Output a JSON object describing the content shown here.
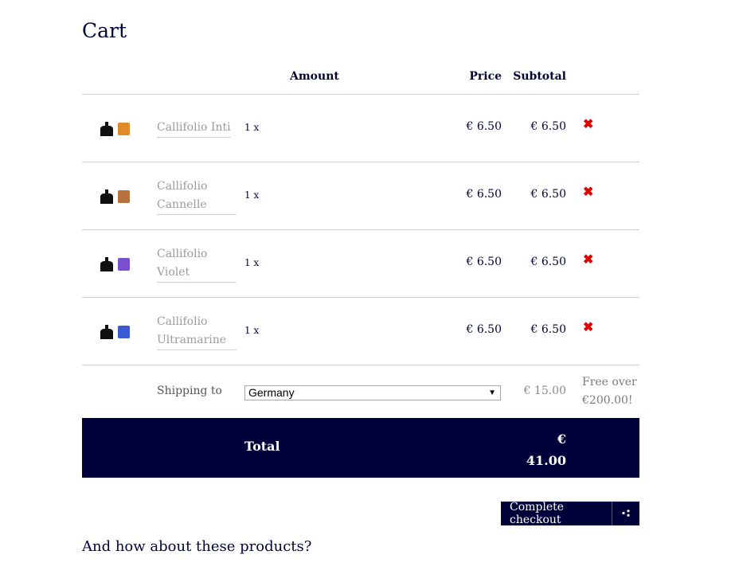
{
  "page": {
    "title": "Cart",
    "suggestions_title": "And how about these products?"
  },
  "table": {
    "headers": {
      "amount": "Amount",
      "price": "Price",
      "subtotal": "Subtotal"
    },
    "items": [
      {
        "name": "Callifolio Inti",
        "qty": "1 x",
        "price": "€ 6.50",
        "subtotal": "€ 6.50",
        "swatch": "#e08a2a"
      },
      {
        "name": "Callifolio Cannelle",
        "qty": "1 x",
        "price": "€ 6.50",
        "subtotal": "€ 6.50",
        "swatch": "#b8703d"
      },
      {
        "name": "Callifolio Violet",
        "qty": "1 x",
        "price": "€ 6.50",
        "subtotal": "€ 6.50",
        "swatch": "#7a4fcf"
      },
      {
        "name": "Callifolio Ultramarine",
        "qty": "1 x",
        "price": "€ 6.50",
        "subtotal": "€ 6.50",
        "swatch": "#3c5ad6"
      }
    ],
    "remove_icon": "✖"
  },
  "shipping": {
    "label": "Shipping to",
    "country": "Germany",
    "cost": "€ 15.00",
    "note": "Free over €200.00!"
  },
  "total": {
    "label": "Total",
    "value": "€ 41.00"
  },
  "checkout": {
    "label": "Complete checkout",
    "icon": "share-icon"
  },
  "colors": {
    "navy": "#02023a",
    "remove": "#e00000"
  }
}
